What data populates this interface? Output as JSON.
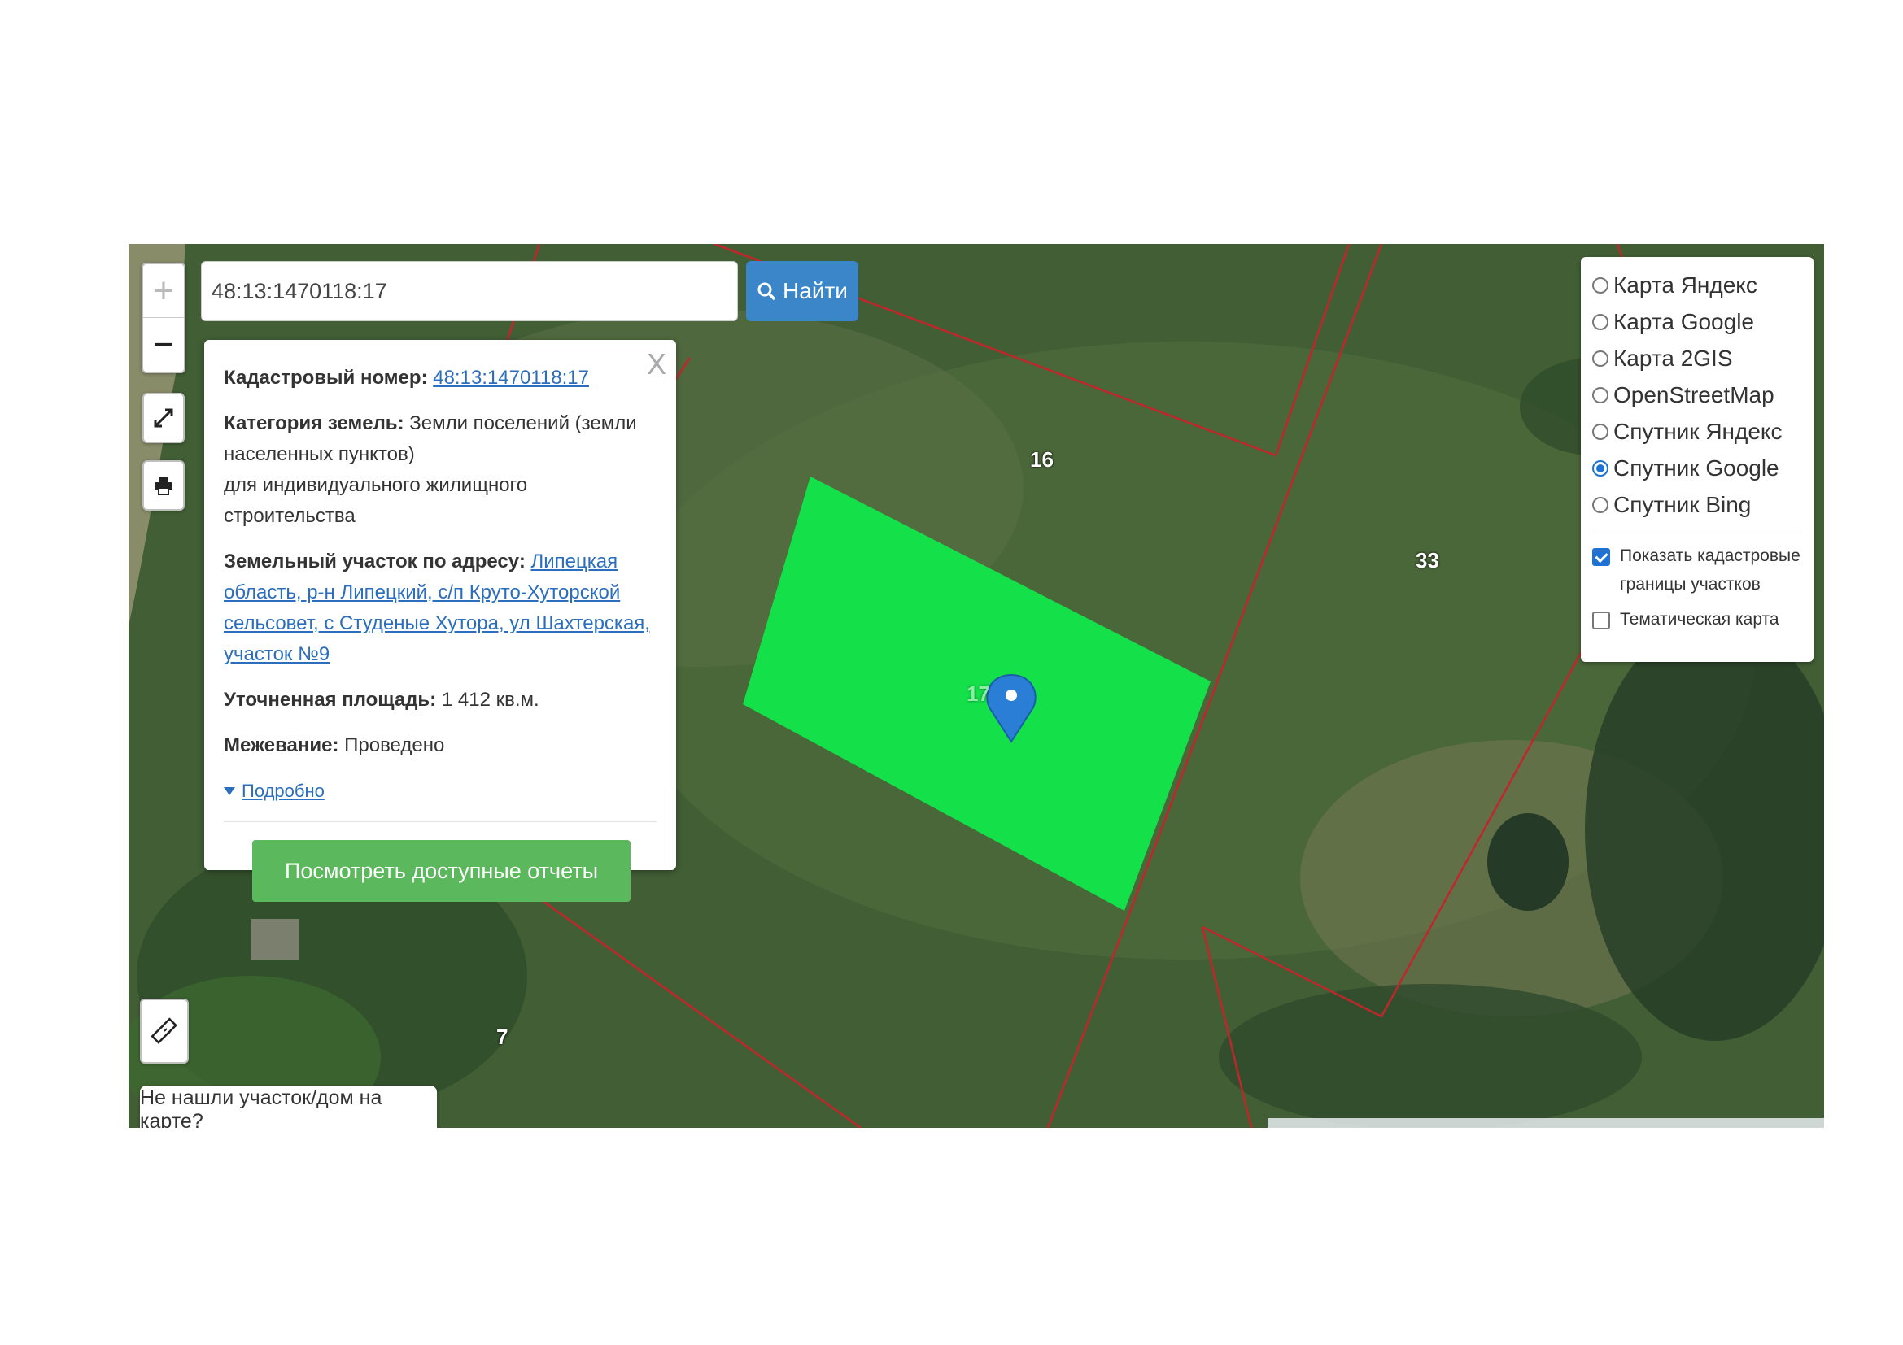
{
  "search": {
    "value": "48:13:1470118:17",
    "button": "Найти"
  },
  "zoom": {
    "in": "+",
    "out": "−"
  },
  "icons": {
    "search": "magnifier-icon",
    "fullscreen": "expand-arrows-icon",
    "print": "printer-icon",
    "ruler": "ruler-icon",
    "close": "close-icon",
    "marker": "map-pin-icon"
  },
  "popup": {
    "close": "X",
    "cadastral_label": "Кадастровый номер:",
    "cadastral_value": "48:13:1470118:17",
    "category_label": "Категория земель:",
    "category_value": "Земли поселений (земли населенных пунктов)",
    "usage": "для индивидуального жилищного строительства",
    "address_label": "Земельный участок по адресу:",
    "address_value": "Липецкая область, р-н Липецкий, с/п Круто-Хуторской сельсовет, с Студеные Хутора, ул Шахтерская, участок №9",
    "area_label": "Уточненная площадь:",
    "area_value": "1 412 кв.м.",
    "survey_label": "Межевание:",
    "survey_value": "Проведено",
    "details": "Подробно",
    "report_button": "Посмотреть доступные отчеты"
  },
  "layers": {
    "options": [
      {
        "label": "Карта Яндекс",
        "selected": false
      },
      {
        "label": "Карта Google",
        "selected": false
      },
      {
        "label": "Карта 2GIS",
        "selected": false
      },
      {
        "label": "OpenStreetMap",
        "selected": false
      },
      {
        "label": "Спутник Яндекс",
        "selected": false
      },
      {
        "label": "Спутник Google",
        "selected": true
      },
      {
        "label": "Спутник Bing",
        "selected": false
      }
    ],
    "show_borders": "Показать кадастровые границы участков",
    "show_borders_checked": true,
    "thematic": "Тематическая карта",
    "thematic_checked": false
  },
  "plots": {
    "p16": "16",
    "p33": "33",
    "p17": "17",
    "p7": "7"
  },
  "not_found": "Не нашли участок/дом на карте?",
  "colors": {
    "selected_plot": "#14e04a",
    "border": "#c0262b",
    "accent": "#3a86c8",
    "report_btn": "#5cb85c"
  }
}
